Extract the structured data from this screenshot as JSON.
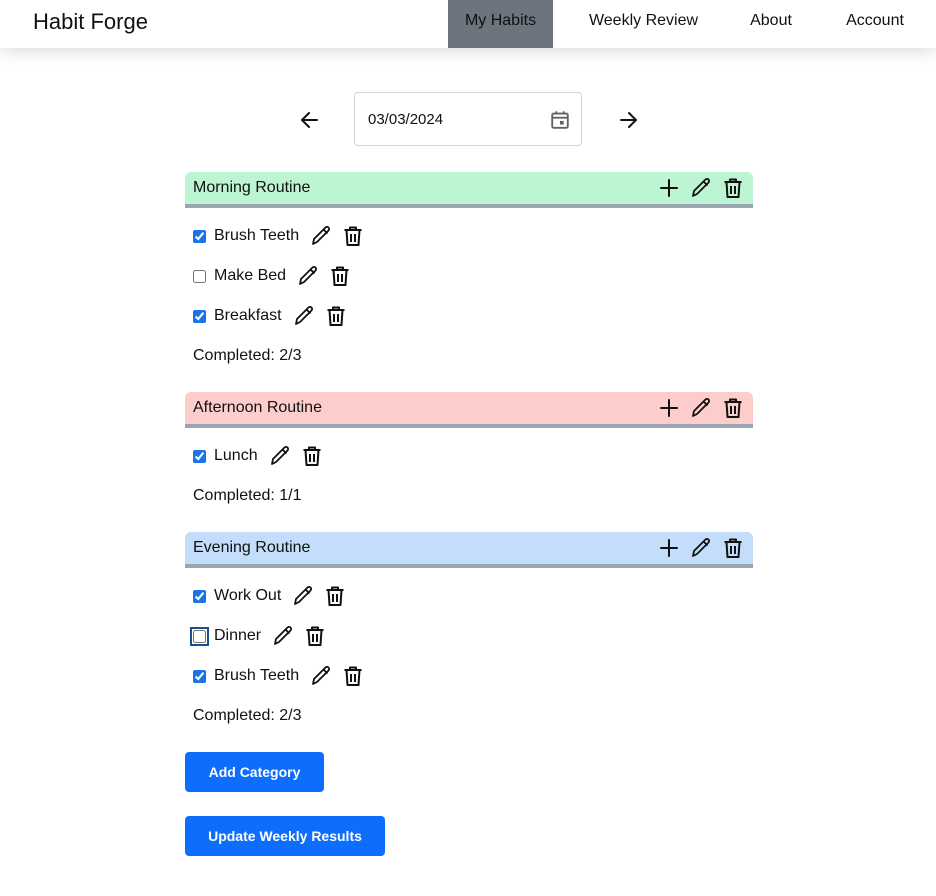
{
  "app": {
    "title": "Habit Forge"
  },
  "nav": {
    "items": [
      {
        "label": "My Habits",
        "active": true
      },
      {
        "label": "Weekly Review",
        "active": false
      },
      {
        "label": "About",
        "active": false
      },
      {
        "label": "Account",
        "active": false
      }
    ],
    "active_bg": "#6c757d"
  },
  "date_picker": {
    "value": "03/03/2024",
    "prev_icon": "arrow-left-icon",
    "next_icon": "arrow-right-icon",
    "calendar_icon": "calendar-icon"
  },
  "categories": [
    {
      "name": "Morning Routine",
      "color": "#bdf5d2",
      "habits": [
        {
          "label": "Brush Teeth",
          "checked": true
        },
        {
          "label": "Make Bed",
          "checked": false
        },
        {
          "label": "Breakfast",
          "checked": true
        }
      ],
      "completed_text": "Completed: 2/3"
    },
    {
      "name": "Afternoon Routine",
      "color": "#fdcdcb",
      "habits": [
        {
          "label": "Lunch",
          "checked": true
        }
      ],
      "completed_text": "Completed: 1/1"
    },
    {
      "name": "Evening Routine",
      "color": "#c4ddfb",
      "habits": [
        {
          "label": "Work Out",
          "checked": true
        },
        {
          "label": "Dinner",
          "checked": false,
          "focused": true
        },
        {
          "label": "Brush Teeth",
          "checked": true
        }
      ],
      "completed_text": "Completed: 2/3"
    }
  ],
  "category_icons": [
    "plus-icon",
    "pencil-icon",
    "trash-icon"
  ],
  "habit_icons": [
    "pencil-icon",
    "trash-icon"
  ],
  "buttons": {
    "add_category": "Add Category",
    "update_weekly": "Update Weekly Results"
  },
  "colors": {
    "primary": "#0d6efd",
    "header_border": "#9aa5b4"
  }
}
